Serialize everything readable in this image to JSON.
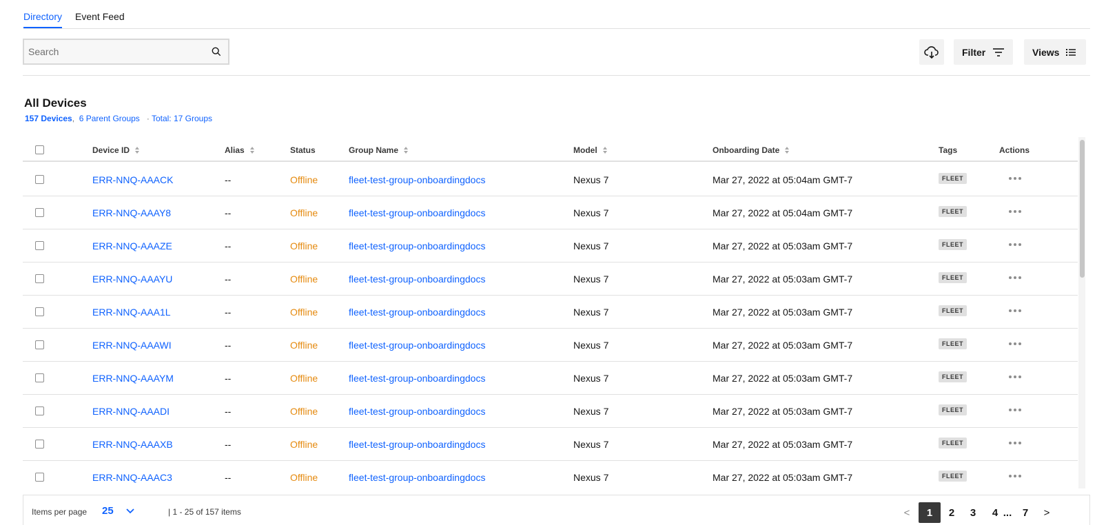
{
  "tabs": [
    {
      "label": "Directory",
      "active": true
    },
    {
      "label": "Event Feed",
      "active": false
    }
  ],
  "search": {
    "placeholder": "Search"
  },
  "toolbar": {
    "filter_label": "Filter",
    "views_label": "Views"
  },
  "header": {
    "title": "All Devices",
    "device_count": "157 Devices",
    "comma": ",",
    "parent_groups": "6 Parent Groups",
    "dot": "·",
    "total_groups": "Total: 17 Groups"
  },
  "table": {
    "columns": [
      "Device ID",
      "Alias",
      "Status",
      "Group Name",
      "Model",
      "Onboarding Date",
      "Tags",
      "Actions"
    ],
    "rows": [
      {
        "device_id": "ERR-NNQ-AAACK",
        "alias": "--",
        "status": "Offline",
        "group": "fleet-test-group-onboardingdocs",
        "model": "Nexus 7",
        "date": "Mar 27, 2022 at 05:04am GMT-7",
        "tag": "FLEET"
      },
      {
        "device_id": "ERR-NNQ-AAAY8",
        "alias": "--",
        "status": "Offline",
        "group": "fleet-test-group-onboardingdocs",
        "model": "Nexus 7",
        "date": "Mar 27, 2022 at 05:04am GMT-7",
        "tag": "FLEET"
      },
      {
        "device_id": "ERR-NNQ-AAAZE",
        "alias": "--",
        "status": "Offline",
        "group": "fleet-test-group-onboardingdocs",
        "model": "Nexus 7",
        "date": "Mar 27, 2022 at 05:03am GMT-7",
        "tag": "FLEET"
      },
      {
        "device_id": "ERR-NNQ-AAAYU",
        "alias": "--",
        "status": "Offline",
        "group": "fleet-test-group-onboardingdocs",
        "model": "Nexus 7",
        "date": "Mar 27, 2022 at 05:03am GMT-7",
        "tag": "FLEET"
      },
      {
        "device_id": "ERR-NNQ-AAA1L",
        "alias": "--",
        "status": "Offline",
        "group": "fleet-test-group-onboardingdocs",
        "model": "Nexus 7",
        "date": "Mar 27, 2022 at 05:03am GMT-7",
        "tag": "FLEET"
      },
      {
        "device_id": "ERR-NNQ-AAAWI",
        "alias": "--",
        "status": "Offline",
        "group": "fleet-test-group-onboardingdocs",
        "model": "Nexus 7",
        "date": "Mar 27, 2022 at 05:03am GMT-7",
        "tag": "FLEET"
      },
      {
        "device_id": "ERR-NNQ-AAAYM",
        "alias": "--",
        "status": "Offline",
        "group": "fleet-test-group-onboardingdocs",
        "model": "Nexus 7",
        "date": "Mar 27, 2022 at 05:03am GMT-7",
        "tag": "FLEET"
      },
      {
        "device_id": "ERR-NNQ-AAADI",
        "alias": "--",
        "status": "Offline",
        "group": "fleet-test-group-onboardingdocs",
        "model": "Nexus 7",
        "date": "Mar 27, 2022 at 05:03am GMT-7",
        "tag": "FLEET"
      },
      {
        "device_id": "ERR-NNQ-AAAXB",
        "alias": "--",
        "status": "Offline",
        "group": "fleet-test-group-onboardingdocs",
        "model": "Nexus 7",
        "date": "Mar 27, 2022 at 05:03am GMT-7",
        "tag": "FLEET"
      },
      {
        "device_id": "ERR-NNQ-AAAC3",
        "alias": "--",
        "status": "Offline",
        "group": "fleet-test-group-onboardingdocs",
        "model": "Nexus 7",
        "date": "Mar 27, 2022 at 05:03am GMT-7",
        "tag": "FLEET"
      }
    ]
  },
  "pagination": {
    "items_per_page_label": "Items per page",
    "items_per_page_value": "25",
    "range_text": "| 1 - 25 of 157 items",
    "prev": "<",
    "next": ">",
    "pages": [
      "1",
      "2",
      "3",
      "4"
    ],
    "ellipsis": "...",
    "last_page": "7",
    "current_page": "1"
  },
  "colors": {
    "accent": "#0f62fe",
    "status_offline": "#e58a0f",
    "active_page": "#393939"
  },
  "icons": [
    "search-icon",
    "cloud-download-icon",
    "filter-icon",
    "list-icon",
    "sort-icon",
    "chevron-down-icon",
    "overflow-menu-icon"
  ]
}
